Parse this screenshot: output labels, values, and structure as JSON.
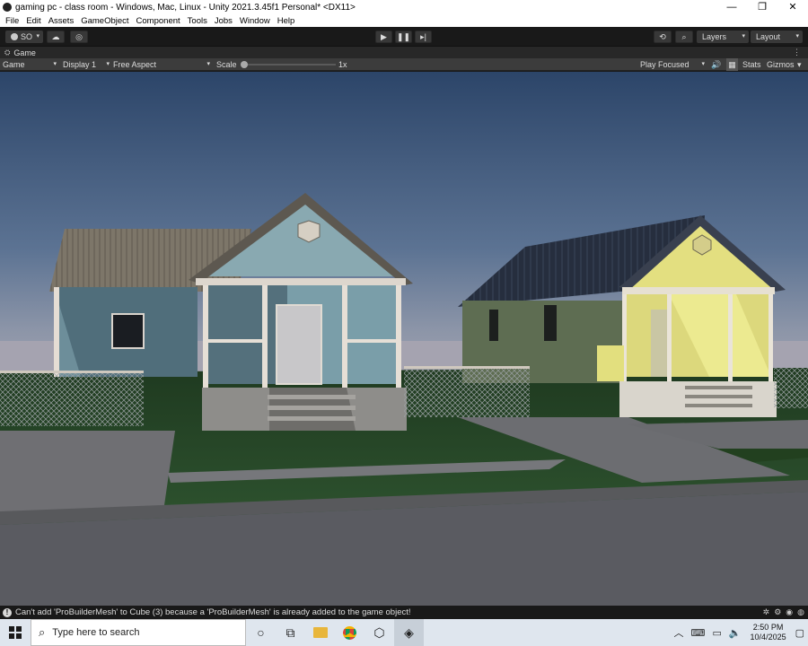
{
  "window": {
    "title": "gaming pc - class room - Windows, Mac, Linux - Unity 2021.3.45f1 Personal* <DX11>",
    "minimize": "—",
    "maximize": "❐",
    "close": "✕"
  },
  "menu": [
    "File",
    "Edit",
    "Assets",
    "GameObject",
    "Component",
    "Tools",
    "Jobs",
    "Window",
    "Help"
  ],
  "toolbar": {
    "account": "SO",
    "layers": "Layers",
    "layout": "Layout"
  },
  "tab": {
    "label": "Game"
  },
  "gamebar": {
    "mode": "Game",
    "display": "Display 1",
    "aspect": "Free Aspect",
    "scale_label": "Scale",
    "scale_value": "1x",
    "play_mode": "Play Focused",
    "stats": "Stats",
    "gizmos": "Gizmos"
  },
  "scale_fraction": 0.02,
  "status": {
    "message": "Can't add 'ProBuilderMesh' to Cube (3) because a 'ProBuilderMesh' is already added to the game object!"
  },
  "taskbar": {
    "search_placeholder": "Type here to search",
    "time": "2:50 PM",
    "date": "10/4/2025",
    "apps": [
      "task-view-icon",
      "file-explorer-icon",
      "chrome-icon",
      "unity-hub-icon",
      "unity-icon"
    ]
  },
  "colors": {
    "editor_bg": "#191919",
    "sky_top": "#2c4569",
    "house_blue": "#7fa3ac",
    "house_yellow": "#e2e07e",
    "grass": "#2d4e2a"
  }
}
